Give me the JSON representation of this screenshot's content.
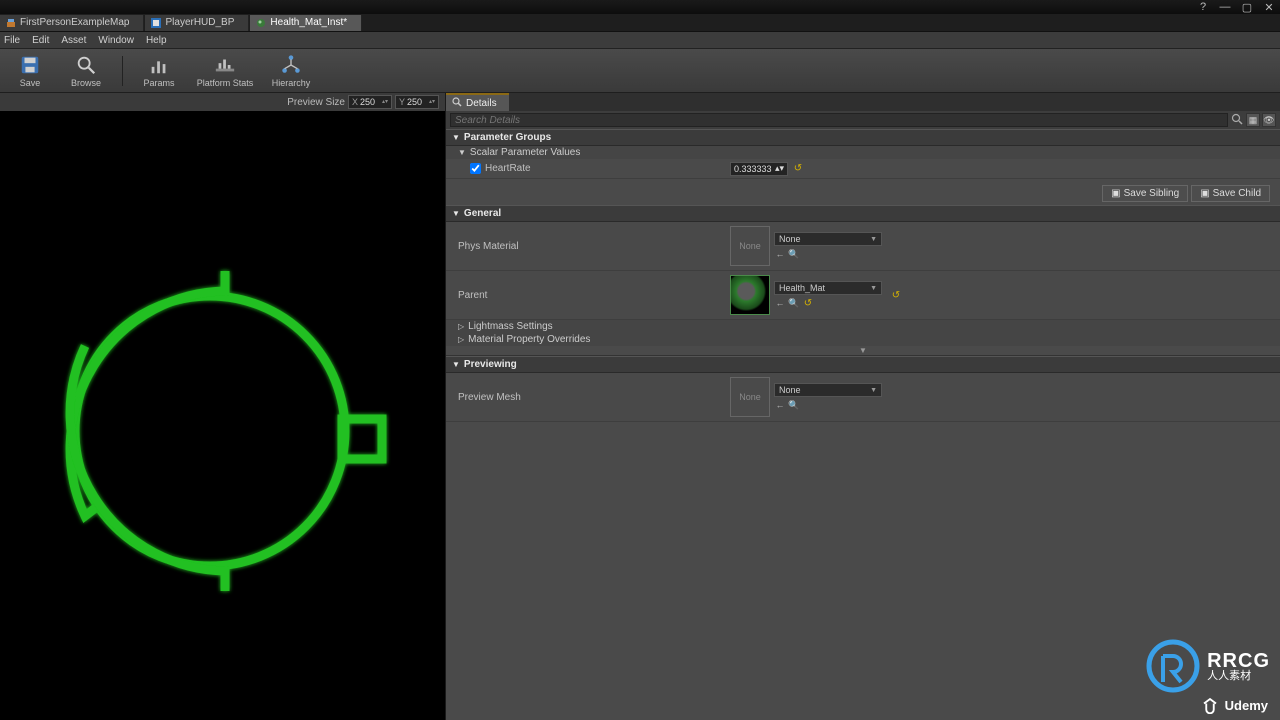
{
  "window": {
    "app_hint": "Unreal Engine Material Instance Editor"
  },
  "tabs": [
    {
      "label": "FirstPersonExampleMap",
      "active": false
    },
    {
      "label": "PlayerHUD_BP",
      "active": false
    },
    {
      "label": "Health_Mat_Inst*",
      "active": true
    }
  ],
  "menu": {
    "file": "File",
    "edit": "Edit",
    "asset": "Asset",
    "window": "Window",
    "help": "Help"
  },
  "toolbar": {
    "save": "Save",
    "browse": "Browse",
    "params": "Params",
    "platform_stats": "Platform Stats",
    "hierarchy": "Hierarchy"
  },
  "viewport": {
    "preview_size_label": "Preview Size",
    "x_label": "X",
    "x_value": "250",
    "y_label": "Y",
    "y_value": "250"
  },
  "details": {
    "tab_label": "Details",
    "search_placeholder": "Search Details",
    "save_sibling": "Save Sibling",
    "save_child": "Save Child",
    "sections": {
      "param_groups": "Parameter Groups",
      "scalar_values": "Scalar Parameter Values",
      "heartrate_label": "HeartRate",
      "heartrate_checked": true,
      "heartrate_value": "0.333333",
      "general": "General",
      "phys_material": "Phys Material",
      "phys_value": "None",
      "parent": "Parent",
      "parent_value": "Health_Mat",
      "lightmass": "Lightmass Settings",
      "mat_overrides": "Material Property Overrides",
      "previewing": "Previewing",
      "preview_mesh": "Preview Mesh",
      "preview_value": "None",
      "none_thumb": "None"
    }
  },
  "branding": {
    "udemy": "Udemy",
    "rrcg": "RRCG",
    "rrcg_sub": "人人素材"
  }
}
